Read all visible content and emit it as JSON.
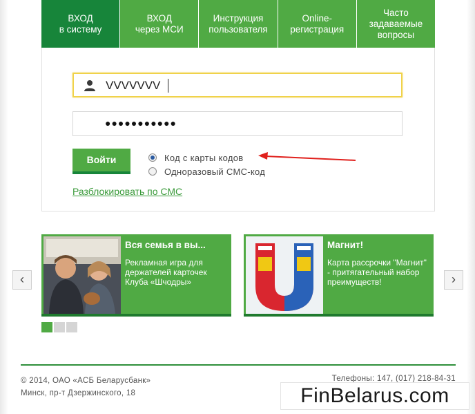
{
  "tabs": [
    {
      "line1": "ВХОД",
      "line2": "в систему"
    },
    {
      "line1": "ВХОД",
      "line2": "через МСИ"
    },
    {
      "line1": "Инструкция",
      "line2": "пользователя"
    },
    {
      "line1": "Online-",
      "line2": "регистрация"
    },
    {
      "line1": "Часто",
      "line2": "задаваемые",
      "line3": "вопросы"
    }
  ],
  "login": {
    "username_value": "VVVVVVV",
    "password_mask": "●●●●●●●●●●●",
    "submit_label": "Войти",
    "auth_options": [
      {
        "label": "Код с карты кодов",
        "checked": true
      },
      {
        "label": "Одноразовый СМС-код",
        "checked": false
      }
    ],
    "unlock_link": "Разблокировать по СМС"
  },
  "banners": [
    {
      "title": "Вся семья в вы...",
      "desc": "Рекламная игра для держателей карточек Клуба «Шчодры»"
    },
    {
      "title": "Магнит!",
      "desc": "Карта рассрочки \"Магнит\" - притягательный набор преимуществ!"
    }
  ],
  "slider": {
    "prev": "‹",
    "next": "›"
  },
  "footer": {
    "copyright": "© 2014, ОАО «АСБ Беларусбанк»",
    "address": "Минск, пр-т Дзержинского, 18",
    "phones": "Телефоны: 147, (017) 218-84-31"
  },
  "watermark": "FinBelarus.com",
  "colors": {
    "primary_green": "#50aa44",
    "dark_green": "#17853a",
    "annotation_red": "#e0201c"
  },
  "icons": {
    "user": "user-icon",
    "arrow": "red-arrow-annotation"
  }
}
